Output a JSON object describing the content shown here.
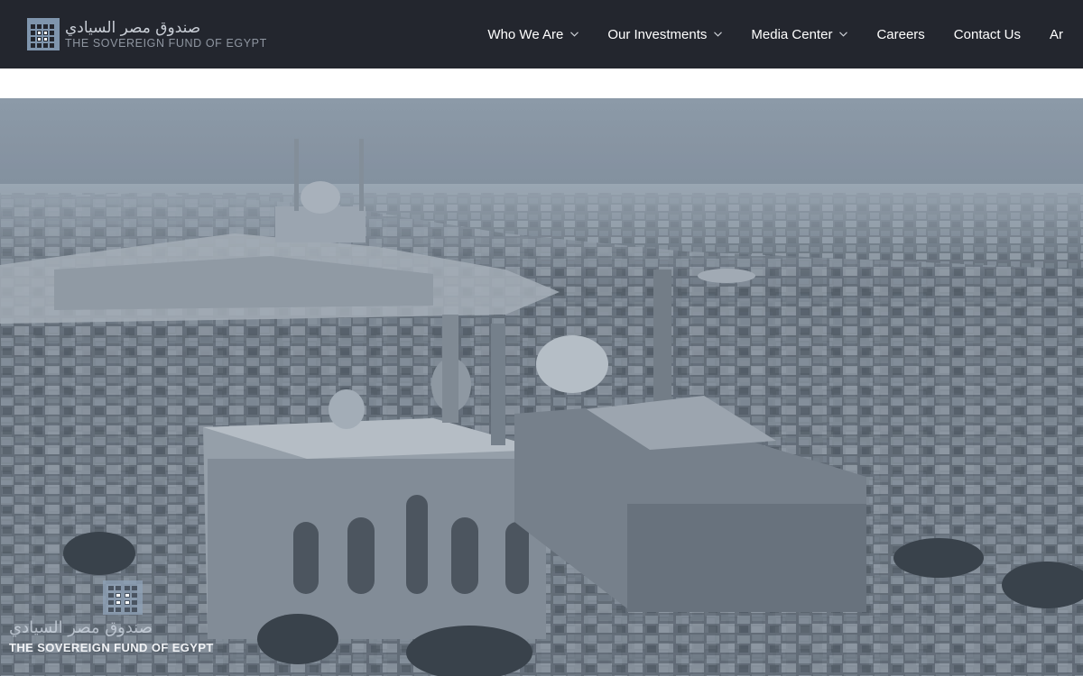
{
  "header": {
    "logo": {
      "arabic_name": "صندوق مصر السيادي",
      "english_name": "THE SOVEREIGN FUND OF EGYPT"
    },
    "nav": {
      "items": [
        {
          "label": "Who We Are",
          "has_dropdown": true
        },
        {
          "label": "Our Investments",
          "has_dropdown": true
        },
        {
          "label": "Media Center",
          "has_dropdown": true
        },
        {
          "label": "Careers",
          "has_dropdown": false
        },
        {
          "label": "Contact Us",
          "has_dropdown": false
        },
        {
          "label": "Ar",
          "has_dropdown": false
        }
      ]
    },
    "colors": {
      "background": "#23262e",
      "text": "#ffffff",
      "logo_accent": "#7f95ad"
    }
  },
  "hero": {
    "image_subject": "aerial-cityscape-image",
    "overlay_logo": {
      "arabic_name": "صندوق مصر السيادي",
      "english_name": "THE SOVEREIGN FUND OF EGYPT"
    }
  }
}
